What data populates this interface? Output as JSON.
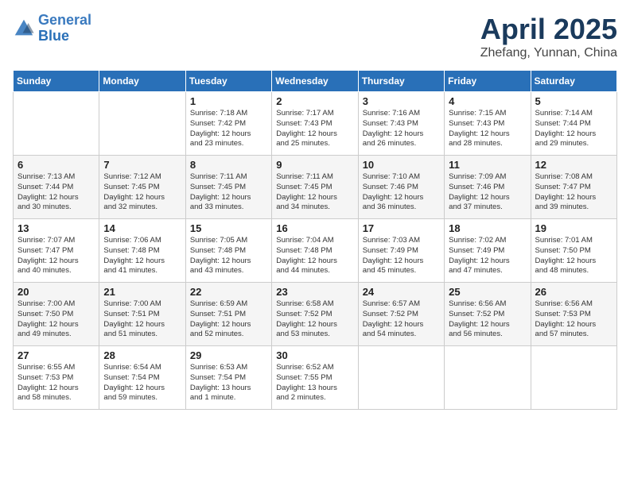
{
  "header": {
    "logo_line1": "General",
    "logo_line2": "Blue",
    "month": "April 2025",
    "location": "Zhefang, Yunnan, China"
  },
  "weekdays": [
    "Sunday",
    "Monday",
    "Tuesday",
    "Wednesday",
    "Thursday",
    "Friday",
    "Saturday"
  ],
  "weeks": [
    [
      {
        "day": "",
        "content": ""
      },
      {
        "day": "",
        "content": ""
      },
      {
        "day": "1",
        "content": "Sunrise: 7:18 AM\nSunset: 7:42 PM\nDaylight: 12 hours\nand 23 minutes."
      },
      {
        "day": "2",
        "content": "Sunrise: 7:17 AM\nSunset: 7:43 PM\nDaylight: 12 hours\nand 25 minutes."
      },
      {
        "day": "3",
        "content": "Sunrise: 7:16 AM\nSunset: 7:43 PM\nDaylight: 12 hours\nand 26 minutes."
      },
      {
        "day": "4",
        "content": "Sunrise: 7:15 AM\nSunset: 7:43 PM\nDaylight: 12 hours\nand 28 minutes."
      },
      {
        "day": "5",
        "content": "Sunrise: 7:14 AM\nSunset: 7:44 PM\nDaylight: 12 hours\nand 29 minutes."
      }
    ],
    [
      {
        "day": "6",
        "content": "Sunrise: 7:13 AM\nSunset: 7:44 PM\nDaylight: 12 hours\nand 30 minutes."
      },
      {
        "day": "7",
        "content": "Sunrise: 7:12 AM\nSunset: 7:45 PM\nDaylight: 12 hours\nand 32 minutes."
      },
      {
        "day": "8",
        "content": "Sunrise: 7:11 AM\nSunset: 7:45 PM\nDaylight: 12 hours\nand 33 minutes."
      },
      {
        "day": "9",
        "content": "Sunrise: 7:11 AM\nSunset: 7:45 PM\nDaylight: 12 hours\nand 34 minutes."
      },
      {
        "day": "10",
        "content": "Sunrise: 7:10 AM\nSunset: 7:46 PM\nDaylight: 12 hours\nand 36 minutes."
      },
      {
        "day": "11",
        "content": "Sunrise: 7:09 AM\nSunset: 7:46 PM\nDaylight: 12 hours\nand 37 minutes."
      },
      {
        "day": "12",
        "content": "Sunrise: 7:08 AM\nSunset: 7:47 PM\nDaylight: 12 hours\nand 39 minutes."
      }
    ],
    [
      {
        "day": "13",
        "content": "Sunrise: 7:07 AM\nSunset: 7:47 PM\nDaylight: 12 hours\nand 40 minutes."
      },
      {
        "day": "14",
        "content": "Sunrise: 7:06 AM\nSunset: 7:48 PM\nDaylight: 12 hours\nand 41 minutes."
      },
      {
        "day": "15",
        "content": "Sunrise: 7:05 AM\nSunset: 7:48 PM\nDaylight: 12 hours\nand 43 minutes."
      },
      {
        "day": "16",
        "content": "Sunrise: 7:04 AM\nSunset: 7:48 PM\nDaylight: 12 hours\nand 44 minutes."
      },
      {
        "day": "17",
        "content": "Sunrise: 7:03 AM\nSunset: 7:49 PM\nDaylight: 12 hours\nand 45 minutes."
      },
      {
        "day": "18",
        "content": "Sunrise: 7:02 AM\nSunset: 7:49 PM\nDaylight: 12 hours\nand 47 minutes."
      },
      {
        "day": "19",
        "content": "Sunrise: 7:01 AM\nSunset: 7:50 PM\nDaylight: 12 hours\nand 48 minutes."
      }
    ],
    [
      {
        "day": "20",
        "content": "Sunrise: 7:00 AM\nSunset: 7:50 PM\nDaylight: 12 hours\nand 49 minutes."
      },
      {
        "day": "21",
        "content": "Sunrise: 7:00 AM\nSunset: 7:51 PM\nDaylight: 12 hours\nand 51 minutes."
      },
      {
        "day": "22",
        "content": "Sunrise: 6:59 AM\nSunset: 7:51 PM\nDaylight: 12 hours\nand 52 minutes."
      },
      {
        "day": "23",
        "content": "Sunrise: 6:58 AM\nSunset: 7:52 PM\nDaylight: 12 hours\nand 53 minutes."
      },
      {
        "day": "24",
        "content": "Sunrise: 6:57 AM\nSunset: 7:52 PM\nDaylight: 12 hours\nand 54 minutes."
      },
      {
        "day": "25",
        "content": "Sunrise: 6:56 AM\nSunset: 7:52 PM\nDaylight: 12 hours\nand 56 minutes."
      },
      {
        "day": "26",
        "content": "Sunrise: 6:56 AM\nSunset: 7:53 PM\nDaylight: 12 hours\nand 57 minutes."
      }
    ],
    [
      {
        "day": "27",
        "content": "Sunrise: 6:55 AM\nSunset: 7:53 PM\nDaylight: 12 hours\nand 58 minutes."
      },
      {
        "day": "28",
        "content": "Sunrise: 6:54 AM\nSunset: 7:54 PM\nDaylight: 12 hours\nand 59 minutes."
      },
      {
        "day": "29",
        "content": "Sunrise: 6:53 AM\nSunset: 7:54 PM\nDaylight: 13 hours\nand 1 minute."
      },
      {
        "day": "30",
        "content": "Sunrise: 6:52 AM\nSunset: 7:55 PM\nDaylight: 13 hours\nand 2 minutes."
      },
      {
        "day": "",
        "content": ""
      },
      {
        "day": "",
        "content": ""
      },
      {
        "day": "",
        "content": ""
      }
    ]
  ]
}
